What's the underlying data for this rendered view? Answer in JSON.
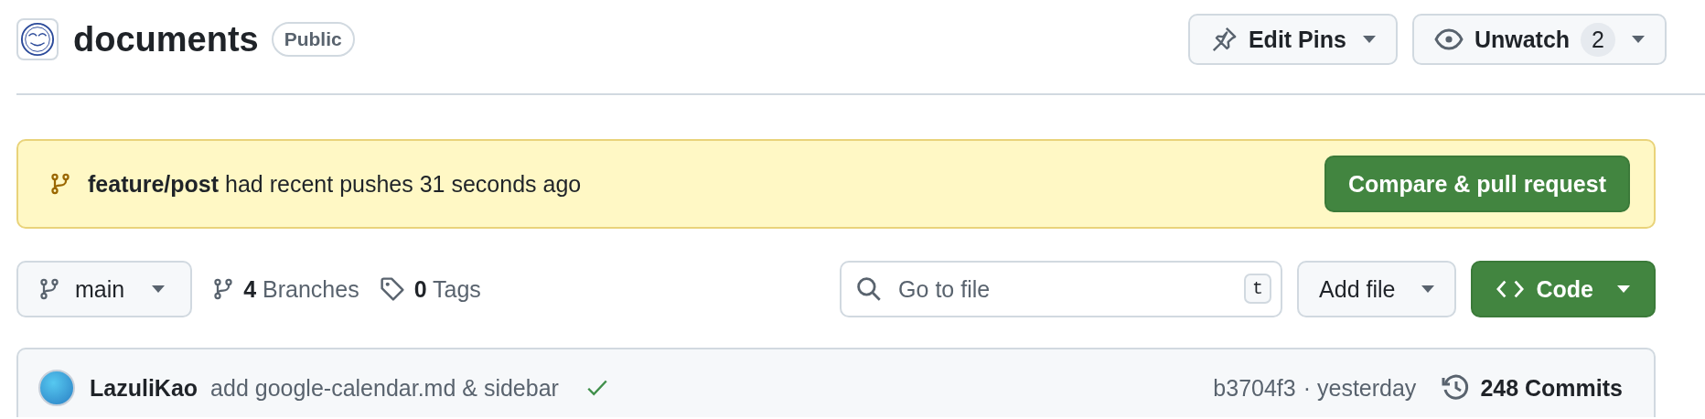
{
  "repo": {
    "name": "documents",
    "visibility": "Public"
  },
  "header_actions": [
    {
      "kind": "pin",
      "label": "Edit Pins"
    },
    {
      "kind": "watch",
      "label": "Unwatch",
      "count": "2"
    }
  ],
  "banner": {
    "message": "**feature/post** had recent pushes 31 seconds ago",
    "button": "Compare & pull request"
  },
  "toolbar": {
    "branch": "main",
    "branches_count": "4",
    "branches_label": "Branches",
    "tags_count": "0",
    "tags_label": "Tags",
    "search": {
      "placeholder": "Go to file",
      "shortcut": "t"
    },
    "add_file": "Add file",
    "code": "Code"
  },
  "latest_commit": {
    "author": "LazuliKao",
    "message": "add google-calendar.md & sidebar",
    "checks_passed": true,
    "hash": "b3704f3",
    "time": "· yesterday",
    "commits": "248 Commits"
  }
}
